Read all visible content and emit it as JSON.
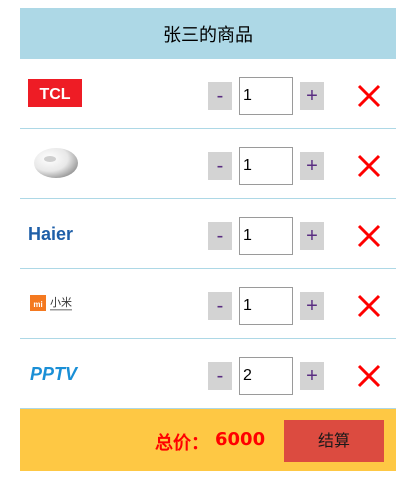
{
  "cart": {
    "title": "张三的商品",
    "items": [
      {
        "brand": "TCL",
        "logo_icon": "tcl-logo",
        "quantity": "1",
        "minus_label": "-",
        "plus_label": "+"
      },
      {
        "brand": "",
        "logo_icon": "white-disc-product-icon",
        "quantity": "1",
        "minus_label": "-",
        "plus_label": "+"
      },
      {
        "brand": "Haier",
        "logo_icon": "haier-logo",
        "quantity": "1",
        "minus_label": "-",
        "plus_label": "+"
      },
      {
        "brand": "小米",
        "logo_icon": "xiaomi-logo",
        "quantity": "1",
        "minus_label": "-",
        "plus_label": "+"
      },
      {
        "brand": "PPTV",
        "logo_icon": "pptv-logo",
        "quantity": "2",
        "minus_label": "-",
        "plus_label": "+"
      }
    ],
    "footer": {
      "total_label": "总价：",
      "total_value": "6000",
      "checkout_label": "结算"
    }
  },
  "colors": {
    "header_bg": "#add8e6",
    "footer_bg": "#fec844",
    "total_text": "#ff0000",
    "checkout_bg": "#dc4b40",
    "delete_x": "#ff0000",
    "stepper_bg": "#d3d3d3"
  }
}
